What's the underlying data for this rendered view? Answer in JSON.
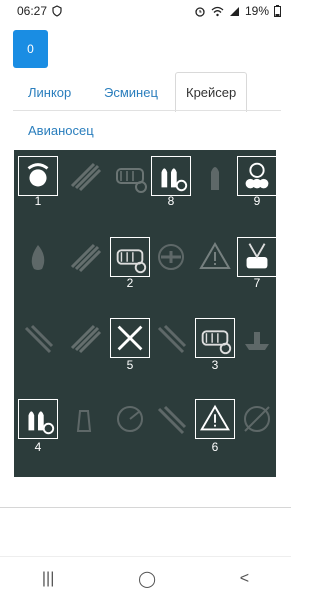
{
  "status": {
    "time": "06:27",
    "battery": "19%"
  },
  "badge": {
    "count": "0"
  },
  "tabs": [
    {
      "label": "Линкор"
    },
    {
      "label": "Эсминец"
    },
    {
      "label": "Крейсер"
    },
    {
      "label": "Авианосец"
    }
  ],
  "grid": {
    "cells": [
      {
        "icon": "crew-icon",
        "number": "1",
        "active": true
      },
      {
        "icon": "rockets-icon",
        "number": "",
        "active": false
      },
      {
        "icon": "torpedo-icon",
        "number": "",
        "active": false
      },
      {
        "icon": "shells-icon",
        "number": "8",
        "active": true
      },
      {
        "icon": "shell-icon",
        "number": "",
        "active": false
      },
      {
        "icon": "wheel-icon",
        "number": "9",
        "active": true
      },
      {
        "icon": "fire-icon",
        "number": "",
        "active": false
      },
      {
        "icon": "rockets-icon",
        "number": "",
        "active": false
      },
      {
        "icon": "torpedo-icon",
        "number": "2",
        "active": true
      },
      {
        "icon": "plane-icon",
        "number": "",
        "active": false
      },
      {
        "icon": "warning-icon",
        "number": "",
        "active": false
      },
      {
        "icon": "searchlight-icon",
        "number": "7",
        "active": true
      },
      {
        "icon": "guns-icon",
        "number": "",
        "active": false
      },
      {
        "icon": "rockets-icon",
        "number": "",
        "active": false
      },
      {
        "icon": "cross-guns-icon",
        "number": "5",
        "active": true
      },
      {
        "icon": "guns-icon",
        "number": "",
        "active": false
      },
      {
        "icon": "torpedo-icon",
        "number": "3",
        "active": true
      },
      {
        "icon": "ship-icon",
        "number": "",
        "active": false
      },
      {
        "icon": "shells-icon",
        "number": "4",
        "active": true
      },
      {
        "icon": "tower-icon",
        "number": "",
        "active": false
      },
      {
        "icon": "radar-icon",
        "number": "",
        "active": false
      },
      {
        "icon": "guns-icon",
        "number": "",
        "active": false
      },
      {
        "icon": "warning-icon",
        "number": "6",
        "active": true
      },
      {
        "icon": "target-icon",
        "number": "",
        "active": false
      }
    ]
  },
  "nav": {
    "recents": "|||",
    "home": "◯",
    "back": "<"
  }
}
